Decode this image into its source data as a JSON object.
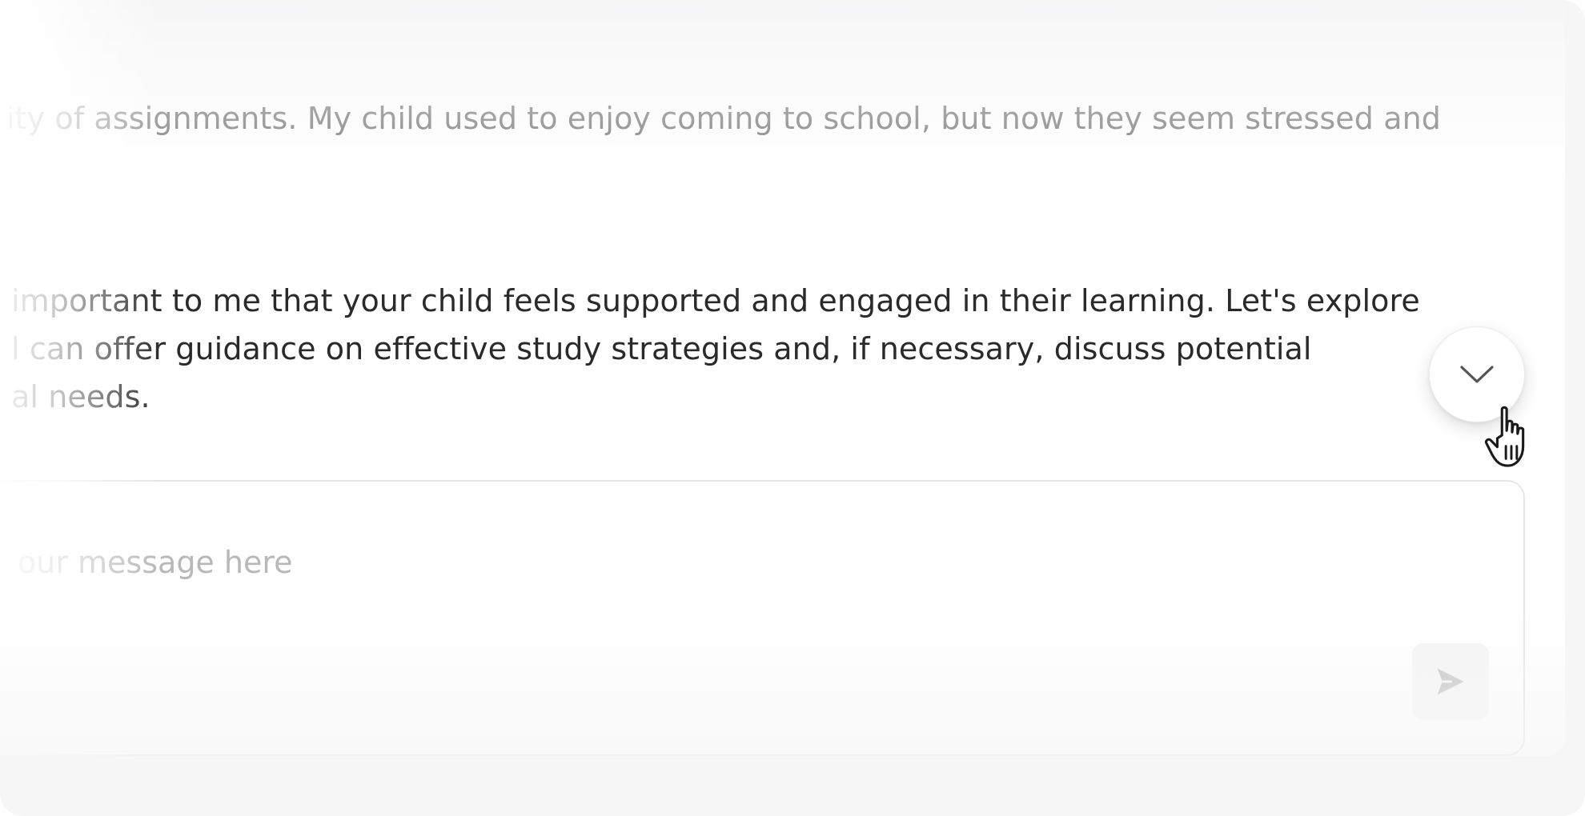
{
  "conversation": {
    "previous_message": "ity of assignments. My child used to enjoy coming to school, but now they seem stressed and",
    "reply_lines": [
      " important to me that your child feels supported and engaged in their learning. Let's explore",
      "l can offer guidance on effective study strategies and, if necessary, discuss potential",
      "al needs."
    ]
  },
  "composer": {
    "placeholder": "our message here"
  },
  "icons": {
    "scroll_down": "chevron-down-icon",
    "send": "send-icon",
    "cursor": "hand-pointer-cursor-icon"
  },
  "colors": {
    "text_primary": "#2a2a2a",
    "text_muted": "#7c7c7c",
    "placeholder": "#b8b8b8",
    "send_icon": "#c4c4c4"
  }
}
